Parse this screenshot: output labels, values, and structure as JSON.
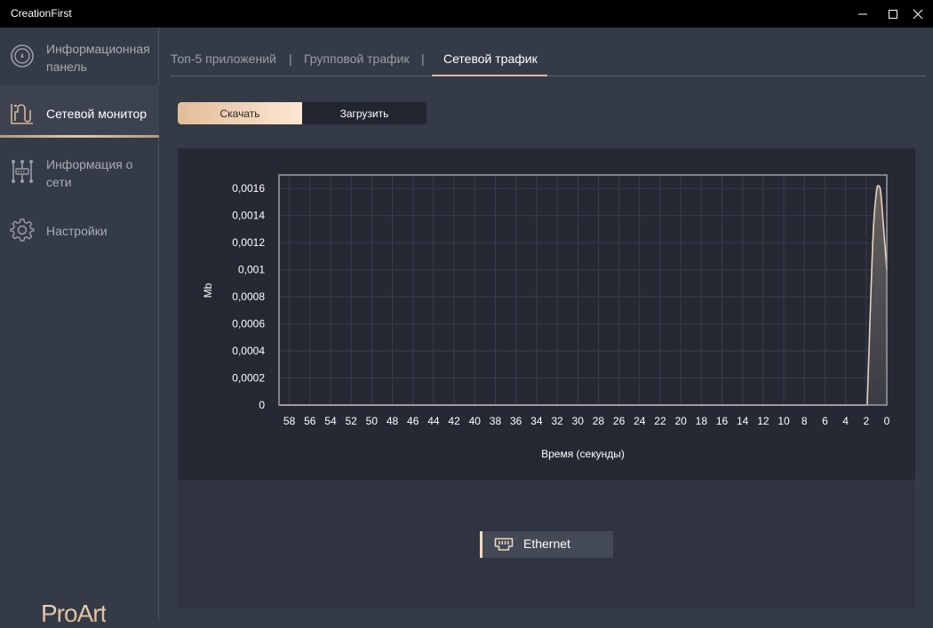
{
  "window": {
    "title": "CreationFirst",
    "controls": {
      "minimize": "—",
      "maximize": "☐",
      "close": "✕"
    }
  },
  "sidebar": {
    "items": [
      {
        "label": "Информационная панель",
        "icon": "dashboard-gauge-icon",
        "active": false
      },
      {
        "label": "Сетевой монитор",
        "icon": "network-monitor-icon",
        "active": true
      },
      {
        "label": "Информация о сети",
        "icon": "network-info-icon",
        "active": false
      },
      {
        "label": "Настройки",
        "icon": "gear-icon",
        "active": false
      }
    ],
    "logo": "ProArt"
  },
  "tabs": {
    "items": [
      {
        "label": "Топ-5 приложений",
        "active": false
      },
      {
        "label": "Групповой трафик",
        "active": false
      },
      {
        "label": "Сетевой трафик",
        "active": true
      }
    ],
    "separator": "|"
  },
  "toggle": {
    "options": [
      {
        "label": "Скачать",
        "selected": true
      },
      {
        "label": "Загрузить",
        "selected": false
      }
    ]
  },
  "colors": {
    "accent": "#d9bb9c",
    "accent_light": "#fde7d4",
    "chart_bg": "#262934",
    "line": "#e8d2bc",
    "grid": "#3a3e4a"
  },
  "chart_data": {
    "type": "area",
    "title": "",
    "xlabel": "Время (секунды)",
    "ylabel": "Mb",
    "xlim": [
      59,
      0
    ],
    "ylim": [
      0,
      0.0017
    ],
    "x_ticks": [
      58,
      56,
      54,
      52,
      50,
      48,
      46,
      44,
      42,
      40,
      38,
      36,
      34,
      32,
      30,
      28,
      26,
      24,
      22,
      20,
      18,
      16,
      14,
      12,
      10,
      8,
      6,
      4,
      2,
      0
    ],
    "y_ticks": [
      0,
      0.0002,
      0.0004,
      0.0006,
      0.0008,
      0.001,
      0.0012,
      0.0014,
      0.0016
    ],
    "y_tick_labels": [
      "0",
      "0,0002",
      "0,0004",
      "0,0006",
      "0,0008",
      "0,001",
      "0,0012",
      "0,0014",
      "0,0016"
    ],
    "grid": true,
    "series": [
      {
        "name": "Ethernet",
        "x": [
          59,
          2,
          1.9,
          1.6,
          1.3,
          1.0,
          0.8,
          0.6,
          0.4,
          0.2,
          0
        ],
        "y": [
          0,
          0,
          0,
          0.0007,
          0.0013,
          0.00158,
          0.00162,
          0.00158,
          0.0014,
          0.0012,
          0.001
        ]
      }
    ],
    "legend": [
      "Ethernet"
    ],
    "legend_position": "bottom-center"
  },
  "legend": {
    "label": "Ethernet",
    "icon": "ethernet-port-icon"
  }
}
